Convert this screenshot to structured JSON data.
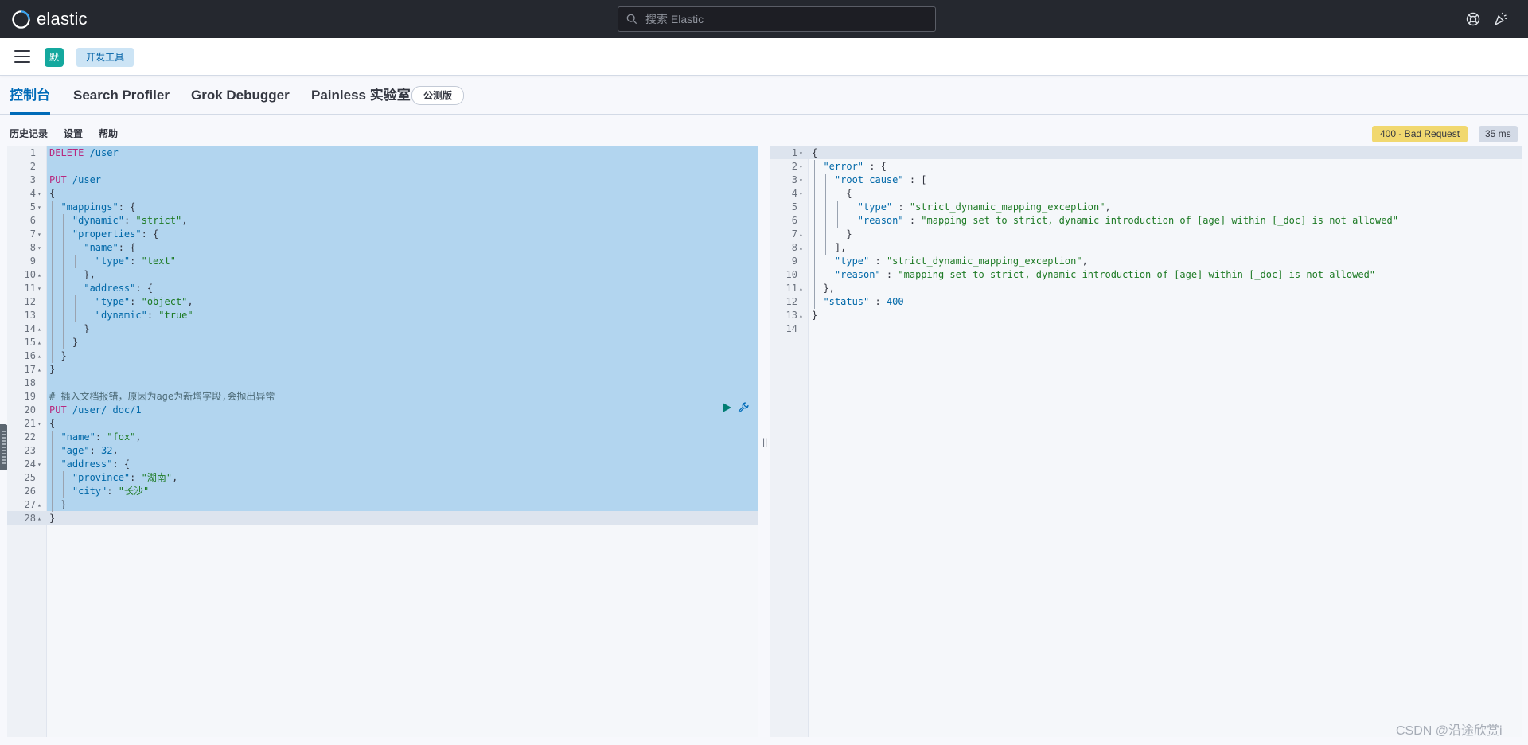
{
  "header": {
    "brand": "elastic",
    "search_placeholder": "搜索 Elastic"
  },
  "breadcrumb": {
    "space_avatar": "默",
    "crumb": "开发工具"
  },
  "tabs": [
    {
      "label": "控制台",
      "active": true
    },
    {
      "label": "Search Profiler"
    },
    {
      "label": "Grok Debugger"
    },
    {
      "label": "Painless 实验室"
    }
  ],
  "beta_badge": "公测版",
  "toolbar": {
    "history": "历史记录",
    "settings": "设置",
    "help": "帮助",
    "status": "400 - Bad Request",
    "time": "35 ms"
  },
  "request_editor": {
    "lines": [
      {
        "n": "1",
        "t": "DELETE /user"
      },
      {
        "n": "2",
        "t": ""
      },
      {
        "n": "3",
        "t": "PUT /user"
      },
      {
        "n": "4",
        "t": "{"
      },
      {
        "n": "5",
        "t": "  \"mappings\": {"
      },
      {
        "n": "6",
        "t": "    \"dynamic\": \"strict\","
      },
      {
        "n": "7",
        "t": "    \"properties\": {"
      },
      {
        "n": "8",
        "t": "      \"name\": {"
      },
      {
        "n": "9",
        "t": "        \"type\": \"text\""
      },
      {
        "n": "10",
        "t": "      },"
      },
      {
        "n": "11",
        "t": "      \"address\": {"
      },
      {
        "n": "12",
        "t": "        \"type\": \"object\","
      },
      {
        "n": "13",
        "t": "        \"dynamic\": \"true\""
      },
      {
        "n": "14",
        "t": "      }"
      },
      {
        "n": "15",
        "t": "    }"
      },
      {
        "n": "16",
        "t": "  }"
      },
      {
        "n": "17",
        "t": "}"
      },
      {
        "n": "18",
        "t": ""
      },
      {
        "n": "19",
        "t": "# 插入文档报错，原因为age为新增字段,会抛出异常"
      },
      {
        "n": "20",
        "t": "PUT /user/_doc/1"
      },
      {
        "n": "21",
        "t": "{"
      },
      {
        "n": "22",
        "t": "  \"name\": \"fox\","
      },
      {
        "n": "23",
        "t": "  \"age\": 32,"
      },
      {
        "n": "24",
        "t": "  \"address\": {"
      },
      {
        "n": "25",
        "t": "    \"province\": \"湖南\","
      },
      {
        "n": "26",
        "t": "    \"city\": \"长沙\""
      },
      {
        "n": "27",
        "t": "  }"
      },
      {
        "n": "28",
        "t": "}"
      }
    ]
  },
  "response_editor": {
    "lines": [
      {
        "n": "1",
        "t": "{"
      },
      {
        "n": "2",
        "t": "  \"error\" : {"
      },
      {
        "n": "3",
        "t": "    \"root_cause\" : ["
      },
      {
        "n": "4",
        "t": "      {"
      },
      {
        "n": "5",
        "t": "        \"type\" : \"strict_dynamic_mapping_exception\","
      },
      {
        "n": "6",
        "t": "        \"reason\" : \"mapping set to strict, dynamic introduction of [age] within [_doc] is not allowed\""
      },
      {
        "n": "7",
        "t": "      }"
      },
      {
        "n": "8",
        "t": "    ],"
      },
      {
        "n": "9",
        "t": "    \"type\" : \"strict_dynamic_mapping_exception\","
      },
      {
        "n": "10",
        "t": "    \"reason\" : \"mapping set to strict, dynamic introduction of [age] within [_doc] is not allowed\""
      },
      {
        "n": "11",
        "t": "  },"
      },
      {
        "n": "12",
        "t": "  \"status\" : 400"
      },
      {
        "n": "13",
        "t": "}"
      },
      {
        "n": "14",
        "t": ""
      }
    ]
  },
  "watermark": "CSDN @沿途欣赏i",
  "colors": {
    "header_bg": "#25282f",
    "accent": "#006bb8",
    "selection": "#b2d5ef",
    "status_warning": "#f1d86f"
  }
}
